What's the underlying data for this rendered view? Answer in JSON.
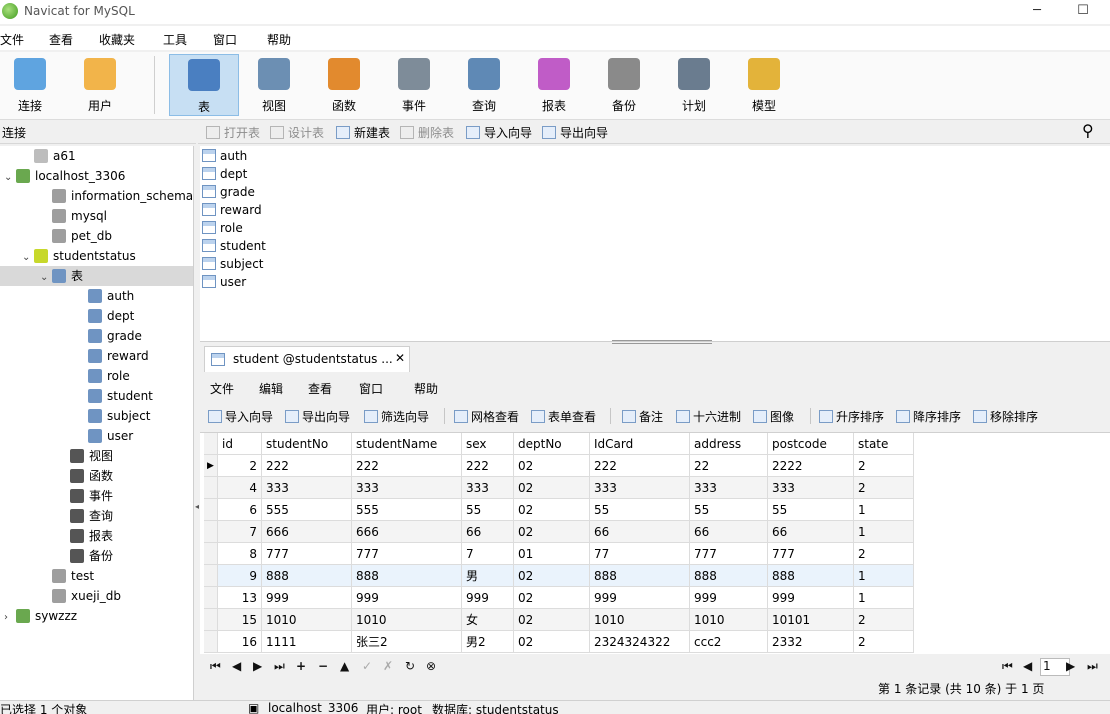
{
  "window": {
    "title": "Navicat for MySQL",
    "minimize": "─",
    "maximize": "☐",
    "close": "✕"
  },
  "menu": [
    "文件",
    "查看",
    "收藏夹",
    "工具",
    "窗口",
    "帮助"
  ],
  "toolbar": [
    {
      "label": "连接",
      "icon": "connection-icon",
      "color": "#5fa4e0"
    },
    {
      "label": "用户",
      "icon": "user-icon",
      "color": "#f2b44a"
    },
    {
      "label": "表",
      "icon": "table-icon",
      "color": "#4a7fc1",
      "active": true
    },
    {
      "label": "视图",
      "icon": "view-icon",
      "color": "#6c8fb3"
    },
    {
      "label": "函数",
      "icon": "function-icon",
      "color": "#e28a2e"
    },
    {
      "label": "事件",
      "icon": "event-icon",
      "color": "#7e8c99"
    },
    {
      "label": "查询",
      "icon": "query-icon",
      "color": "#5f89b5"
    },
    {
      "label": "报表",
      "icon": "report-icon",
      "color": "#c05cc7"
    },
    {
      "label": "备份",
      "icon": "backup-icon",
      "color": "#8a8a8a"
    },
    {
      "label": "计划",
      "icon": "schedule-icon",
      "color": "#6a7c8f"
    },
    {
      "label": "模型",
      "icon": "model-icon",
      "color": "#e3b33a"
    }
  ],
  "connection_header": "连接",
  "subtoolbar": [
    {
      "label": "打开表",
      "disabled": true
    },
    {
      "label": "设计表",
      "disabled": true
    },
    {
      "label": "新建表",
      "disabled": false
    },
    {
      "label": "删除表",
      "disabled": true
    },
    {
      "label": "导入向导",
      "disabled": false
    },
    {
      "label": "导出向导",
      "disabled": false
    }
  ],
  "tree": [
    {
      "label": "a61",
      "level": 1,
      "arrow": "",
      "icon": "connection-icon",
      "color": "#bdbdbd"
    },
    {
      "label": "localhost_3306",
      "level": 0,
      "arrow": "⌄",
      "icon": "connection-icon",
      "color": "#6aa84f"
    },
    {
      "label": "information_schema",
      "level": 2,
      "arrow": "",
      "icon": "database-icon",
      "color": "#9e9e9e"
    },
    {
      "label": "mysql",
      "level": 2,
      "arrow": "",
      "icon": "database-icon",
      "color": "#9e9e9e"
    },
    {
      "label": "pet_db",
      "level": 2,
      "arrow": "",
      "icon": "database-icon",
      "color": "#9e9e9e"
    },
    {
      "label": "studentstatus",
      "level": 1,
      "arrow": "⌄",
      "icon": "database-icon",
      "color": "#c7d82b"
    },
    {
      "label": "表",
      "level": 2,
      "arrow": "⌄",
      "icon": "table-icon",
      "color": "#6f94c2",
      "selected": true
    },
    {
      "label": "auth",
      "level": 4,
      "arrow": "",
      "icon": "table-icon",
      "color": "#6f94c2"
    },
    {
      "label": "dept",
      "level": 4,
      "arrow": "",
      "icon": "table-icon",
      "color": "#6f94c2"
    },
    {
      "label": "grade",
      "level": 4,
      "arrow": "",
      "icon": "table-icon",
      "color": "#6f94c2"
    },
    {
      "label": "reward",
      "level": 4,
      "arrow": "",
      "icon": "table-icon",
      "color": "#6f94c2"
    },
    {
      "label": "role",
      "level": 4,
      "arrow": "",
      "icon": "table-icon",
      "color": "#6f94c2"
    },
    {
      "label": "student",
      "level": 4,
      "arrow": "",
      "icon": "table-icon",
      "color": "#6f94c2"
    },
    {
      "label": "subject",
      "level": 4,
      "arrow": "",
      "icon": "table-icon",
      "color": "#6f94c2"
    },
    {
      "label": "user",
      "level": 4,
      "arrow": "",
      "icon": "table-icon",
      "color": "#6f94c2"
    },
    {
      "label": "视图",
      "level": 3,
      "arrow": "",
      "icon": "view-icon",
      "color": "#555555"
    },
    {
      "label": "函数",
      "level": 3,
      "arrow": "",
      "icon": "function-icon",
      "color": "#555555"
    },
    {
      "label": "事件",
      "level": 3,
      "arrow": "",
      "icon": "event-icon",
      "color": "#555555"
    },
    {
      "label": "查询",
      "level": 3,
      "arrow": "",
      "icon": "query-icon",
      "color": "#555555"
    },
    {
      "label": "报表",
      "level": 3,
      "arrow": "",
      "icon": "report-icon",
      "color": "#555555"
    },
    {
      "label": "备份",
      "level": 3,
      "arrow": "",
      "icon": "backup-icon",
      "color": "#555555"
    },
    {
      "label": "test",
      "level": 2,
      "arrow": "",
      "icon": "database-icon",
      "color": "#9e9e9e"
    },
    {
      "label": "xueji_db",
      "level": 2,
      "arrow": "",
      "icon": "database-icon",
      "color": "#9e9e9e"
    },
    {
      "label": "sywzzz",
      "level": 0,
      "arrow": "›",
      "icon": "connection-icon",
      "color": "#6aa84f"
    }
  ],
  "objects": [
    "auth",
    "dept",
    "grade",
    "reward",
    "role",
    "student",
    "subject",
    "user"
  ],
  "doc_tab": {
    "label": "student @studentstatus ...",
    "close": "✕"
  },
  "table_menu": [
    "文件",
    "编辑",
    "查看",
    "窗口",
    "帮助"
  ],
  "table_toolbar": [
    "导入向导",
    "导出向导",
    "筛选向导",
    "网格查看",
    "表单查看",
    "备注",
    "十六进制",
    "图像",
    "升序排序",
    "降序排序",
    "移除排序"
  ],
  "grid": {
    "columns": [
      "id",
      "studentNo",
      "studentName",
      "sex",
      "deptNo",
      "IdCard",
      "address",
      "postcode",
      "state"
    ],
    "rows": [
      [
        "2",
        "222",
        "222",
        "222",
        "02",
        "222",
        "22",
        "2222",
        "2"
      ],
      [
        "4",
        "333",
        "333",
        "333",
        "02",
        "333",
        "333",
        "333",
        "2"
      ],
      [
        "6",
        "555",
        "555",
        "55",
        "02",
        "55",
        "55",
        "55",
        "1"
      ],
      [
        "7",
        "666",
        "666",
        "66",
        "02",
        "66",
        "66",
        "66",
        "1"
      ],
      [
        "8",
        "777",
        "777",
        "7",
        "01",
        "77",
        "777",
        "777",
        "2"
      ],
      [
        "9",
        "888",
        "888",
        "男",
        "02",
        "888",
        "888",
        "888",
        "1"
      ],
      [
        "13",
        "999",
        "999",
        "999",
        "02",
        "999",
        "999",
        "999",
        "1"
      ],
      [
        "15",
        "1010",
        "1010",
        "女",
        "02",
        "1010",
        "1010",
        "10101",
        "2"
      ],
      [
        "16",
        "1111",
        "张三2",
        "男2",
        "02",
        "2324324322",
        "ccc2",
        "2332",
        "2"
      ]
    ],
    "current_row_marker": "▶"
  },
  "nav_buttons": [
    "⏮",
    "◀",
    "▶",
    "⏭",
    "+",
    "−",
    "▲",
    "✓",
    "✗",
    "↻",
    "⊗"
  ],
  "page_nav": {
    "first": "⏮",
    "prev": "◀",
    "page": "1",
    "next": "▶",
    "last": "⏭"
  },
  "record_status": "第 1 条记录 (共 10 条) 于 1 页",
  "status": {
    "selected": "已选择 1 个对象",
    "connection": "localhost_3306",
    "user": "用户: root",
    "database": "数据库: studentstatus"
  }
}
